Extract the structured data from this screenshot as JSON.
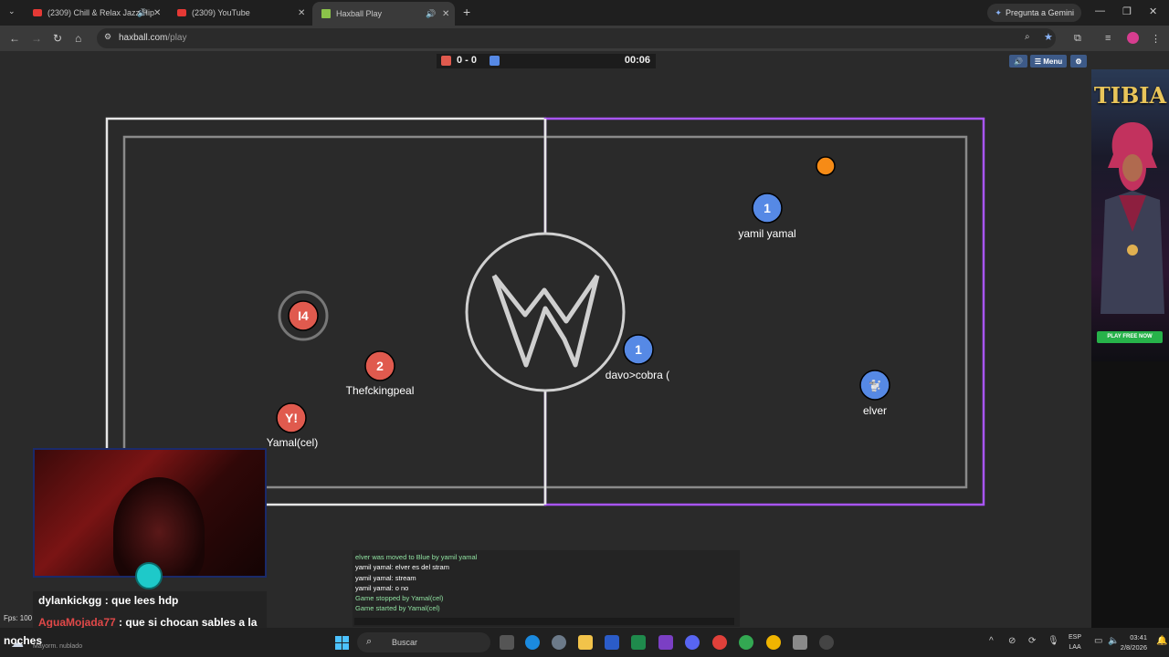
{
  "browser": {
    "tabs": [
      {
        "title": "(2309) Chill & Relax Jazz Hip",
        "audio_icon": "speaker-icon"
      },
      {
        "title": "(2309) YouTube",
        "audio_icon": "speaker-icon"
      },
      {
        "title": "Haxball Play",
        "audio_icon": "speaker-icon"
      }
    ],
    "gemini_label": "Pregunta a Gemini",
    "url_host": "haxball.com",
    "url_path": "/play",
    "new_tab": "+",
    "close_glyph": "✕"
  },
  "game": {
    "score": "0 - 0",
    "time": "00:06",
    "red_color": "#e05a4e",
    "blue_color": "#5689e5",
    "menu_label": "☰ Menu",
    "players": [
      {
        "team": "red",
        "avatar": "I4",
        "name": ""
      },
      {
        "team": "red",
        "avatar": "2",
        "name": "Thefckingpeal"
      },
      {
        "team": "red",
        "avatar": "Y!",
        "name": "Yamal(cel)"
      },
      {
        "team": "blue",
        "avatar": "1",
        "name": "yamil yamal"
      },
      {
        "team": "blue",
        "avatar": "1",
        "name": "davo>cobra ("
      },
      {
        "team": "blue",
        "avatar": "🐩",
        "name": "elver"
      }
    ]
  },
  "ad": {
    "brand": "TIBIA",
    "cta": "PLAY FREE NOW"
  },
  "overlay": {
    "fps": "Fps: 100",
    "stream_chat": [
      {
        "user": "dylankickgg",
        "text": ": que lees hdp"
      },
      {
        "user": "AguaMojada77",
        "text": ": que si chocan sables a la"
      }
    ],
    "stream_chat_cont": "noches"
  },
  "game_chat": [
    {
      "text": "elver was moved to Blue by yamil yamal",
      "kind": "notice"
    },
    {
      "text": "yamil yamal: elver es del stram",
      "kind": "msg"
    },
    {
      "text": "yamil yamal: stream",
      "kind": "msg"
    },
    {
      "text": "yamil yamal: o no",
      "kind": "msg"
    },
    {
      "text": "Game stopped by Yamal(cel)",
      "kind": "notice"
    },
    {
      "text": "Game started by Yamal(cel)",
      "kind": "notice"
    }
  ],
  "taskbar": {
    "weather": "Mayorm. nublado",
    "search_placeholder": "Buscar",
    "lang_top": "ESP",
    "lang_bottom": "LAA",
    "time": "03:41",
    "date": "2/8/2026"
  }
}
